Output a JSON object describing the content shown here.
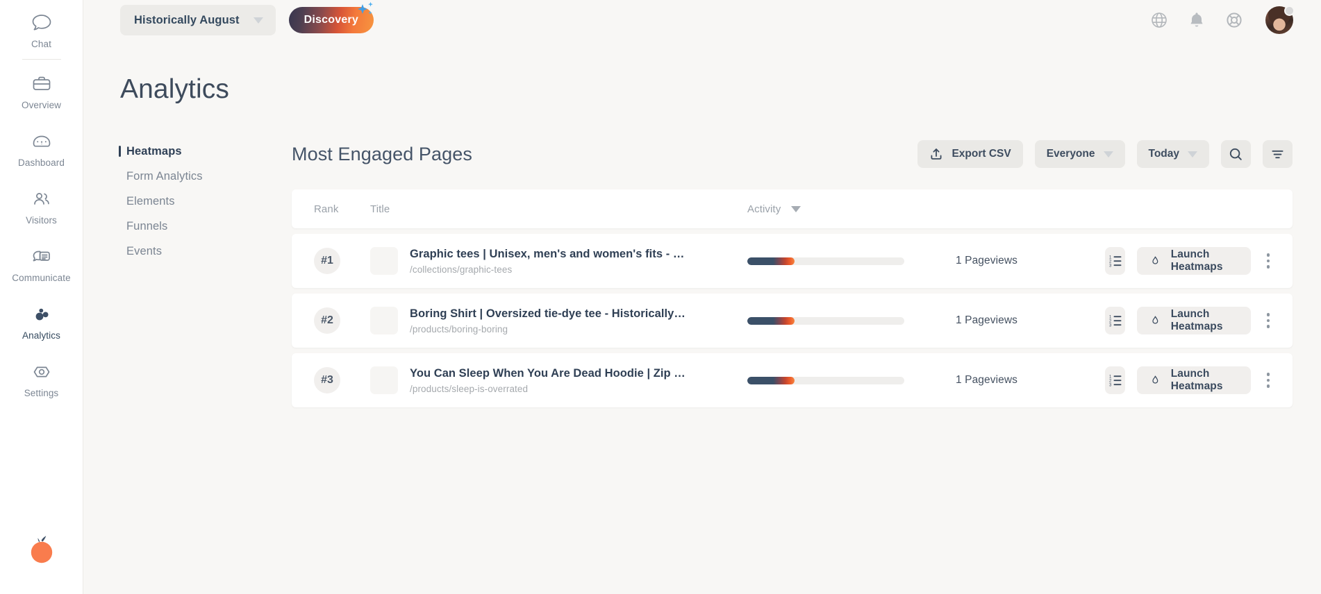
{
  "rail": {
    "items": [
      {
        "label": "Chat",
        "icon": "chat-icon",
        "active": false
      },
      {
        "label": "Overview",
        "icon": "briefcase-icon",
        "active": false
      },
      {
        "label": "Dashboard",
        "icon": "gauge-info-icon",
        "active": false
      },
      {
        "label": "Visitors",
        "icon": "people-icon",
        "active": false
      },
      {
        "label": "Communicate",
        "icon": "message-icon",
        "active": false
      },
      {
        "label": "Analytics",
        "icon": "bubbles-icon",
        "active": true
      },
      {
        "label": "Settings",
        "icon": "hexagon-eye-icon",
        "active": false
      }
    ],
    "logo": "lucky-orange-logo"
  },
  "topbar": {
    "site_selector": {
      "label": "Historically August",
      "icon": "chevron-down-icon"
    },
    "discovery_label": "Discovery",
    "icons": [
      "globe-icon",
      "bell-icon",
      "lifebuoy-icon"
    ],
    "avatar": "user-avatar"
  },
  "page": {
    "title": "Analytics"
  },
  "subnav": {
    "items": [
      {
        "label": "Heatmaps",
        "active": true
      },
      {
        "label": "Form Analytics",
        "active": false
      },
      {
        "label": "Elements",
        "active": false
      },
      {
        "label": "Funnels",
        "active": false
      },
      {
        "label": "Events",
        "active": false
      }
    ]
  },
  "content": {
    "title": "Most Engaged Pages",
    "toolbar": {
      "export_label": "Export CSV",
      "segment_label": "Everyone",
      "date_label": "Today",
      "search_icon": "search-icon",
      "filter_icon": "filter-icon"
    }
  },
  "table": {
    "headers": {
      "rank": "Rank",
      "title": "Title",
      "activity": "Activity"
    },
    "rows": [
      {
        "rank": "#1",
        "title": "Graphic tees | Unisex, men's and women's fits - Histori...",
        "url": "/collections/graphic-tees",
        "activity_pct": 30,
        "views": "1 Pageviews",
        "list_icon": "numbered-list-icon",
        "launch_label": "Launch Heatmaps",
        "launch_icon": "flame-icon",
        "menu_icon": "kebab-menu-icon"
      },
      {
        "rank": "#2",
        "title": "Boring Shirt | Oversized tie-dye tee - Historically August",
        "url": "/products/boring-boring",
        "activity_pct": 30,
        "views": "1 Pageviews",
        "list_icon": "numbered-list-icon",
        "launch_label": "Launch Heatmaps",
        "launch_icon": "flame-icon",
        "menu_icon": "kebab-menu-icon"
      },
      {
        "rank": "#3",
        "title": "You Can Sleep When You Are Dead Hoodie | Zip hoodi...",
        "url": "/products/sleep-is-overrated",
        "activity_pct": 30,
        "views": "1 Pageviews",
        "list_icon": "numbered-list-icon",
        "launch_label": "Launch Heatmaps",
        "launch_icon": "flame-icon",
        "menu_icon": "kebab-menu-icon"
      }
    ]
  },
  "colors": {
    "background": "#f8f7f5",
    "navy": "#2f4056",
    "orange": "#f7793b",
    "muted": "#7b8592",
    "card": "#ffffff",
    "chip": "#eae9e6"
  }
}
